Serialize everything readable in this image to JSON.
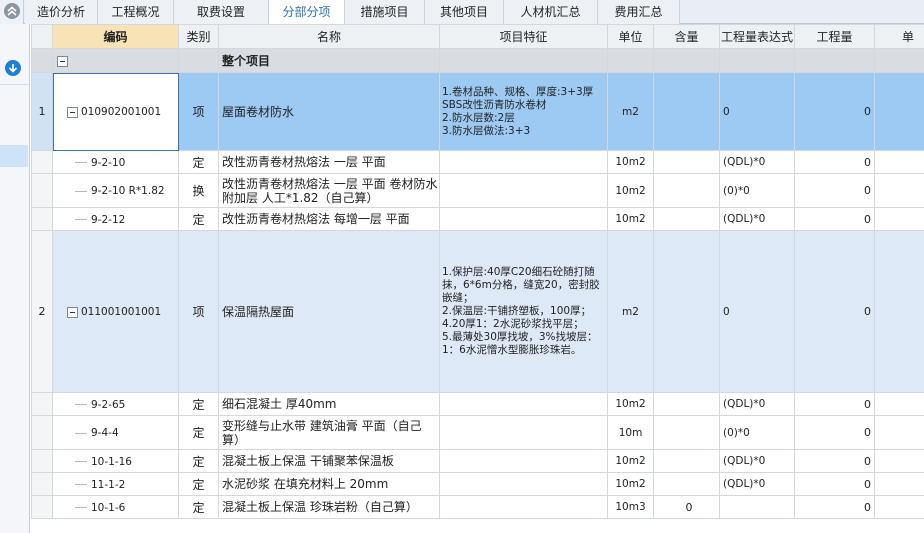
{
  "tabs": [
    {
      "label": "造价分析",
      "active": false
    },
    {
      "label": "工程概况",
      "active": false
    },
    {
      "label": "取费设置",
      "active": false
    },
    {
      "label": "分部分项",
      "active": true
    },
    {
      "label": "措施项目",
      "active": false
    },
    {
      "label": "其他项目",
      "active": false
    },
    {
      "label": "人材机汇总",
      "active": false
    },
    {
      "label": "费用汇总",
      "active": false
    }
  ],
  "icons": {
    "collapse": "chevron-up-icon",
    "left_action": "download-arrow-icon"
  },
  "colors": {
    "selected_row": "#9ccaf3",
    "item_row": "#dde9f6",
    "summary_row": "#d9dde2",
    "active_tab_text": "#2e6fb8",
    "sort_header": "#f7e3b6"
  },
  "columns": [
    "",
    "编码",
    "类别",
    "名称",
    "项目特征",
    "单位",
    "含量",
    "工程量表达式",
    "工程量",
    "单"
  ],
  "summary": {
    "title": "整个项目"
  },
  "rows": [
    {
      "kind": "item",
      "num": "1",
      "code": "010902001001",
      "cls": "项",
      "name": "屋面卷材防水",
      "feature": "1.卷材品种、规格、厚度:3+3厚SBS改性沥青防水卷材\n2.防水层数:2层\n3.防水层做法:3+3",
      "unit": "m2",
      "content": "",
      "expr": "0",
      "qty": "0",
      "selected": true
    },
    {
      "kind": "sub",
      "num": "",
      "code": "9-2-10",
      "cls": "定",
      "name": "改性沥青卷材热熔法 一层 平面",
      "feature": "",
      "unit": "10m2",
      "content": "",
      "expr": "(QDL)*0",
      "qty": "0"
    },
    {
      "kind": "sub",
      "num": "",
      "code": "9-2-10 R*1.82",
      "cls": "换",
      "name": "改性沥青卷材热熔法 一层 平面  卷材防水附加层 人工*1.82（自己算）",
      "feature": "",
      "unit": "10m2",
      "content": "",
      "expr": "(0)*0",
      "qty": "0"
    },
    {
      "kind": "sub",
      "num": "",
      "code": "9-2-12",
      "cls": "定",
      "name": "改性沥青卷材热熔法 每增一层 平面",
      "feature": "",
      "unit": "10m2",
      "content": "",
      "expr": "(QDL)*0",
      "qty": "0"
    },
    {
      "kind": "item",
      "num": "2",
      "code": "011001001001",
      "cls": "项",
      "name": "保温隔热屋面",
      "feature": "1.保护层:40厚C20细石砼随打随抹，6*6m分格，缝宽20，密封胶嵌缝；\n2.保温层:干铺挤塑板，100厚；\n4.20厚1：2水泥砂浆找平层；\n5.最薄处30厚找坡，3%找坡层：1：6水泥憎水型膨胀珍珠岩。",
      "unit": "m2",
      "content": "",
      "expr": "0",
      "qty": "0",
      "selected": false
    },
    {
      "kind": "sub",
      "num": "",
      "code": "9-2-65",
      "cls": "定",
      "name": "细石混凝土 厚40mm",
      "feature": "",
      "unit": "10m2",
      "content": "",
      "expr": "(QDL)*0",
      "qty": "0"
    },
    {
      "kind": "sub",
      "num": "",
      "code": "9-4-4",
      "cls": "定",
      "name": "变形缝与止水带 建筑油膏 平面（自己算）",
      "feature": "",
      "unit": "10m",
      "content": "",
      "expr": "(0)*0",
      "qty": "0"
    },
    {
      "kind": "sub",
      "num": "",
      "code": "10-1-16",
      "cls": "定",
      "name": "混凝土板上保温 干铺聚苯保温板",
      "feature": "",
      "unit": "10m2",
      "content": "",
      "expr": "(QDL)*0",
      "qty": "0"
    },
    {
      "kind": "sub",
      "num": "",
      "code": "11-1-2",
      "cls": "定",
      "name": "水泥砂浆 在填充材料上 20mm",
      "feature": "",
      "unit": "10m2",
      "content": "",
      "expr": "(QDL)*0",
      "qty": "0"
    },
    {
      "kind": "sub",
      "num": "",
      "code": "10-1-6",
      "cls": "定",
      "name": "混凝土板上保温 珍珠岩粉（自己算）",
      "feature": "",
      "unit": "10m3",
      "content": "0",
      "expr": "",
      "qty": "0"
    }
  ]
}
